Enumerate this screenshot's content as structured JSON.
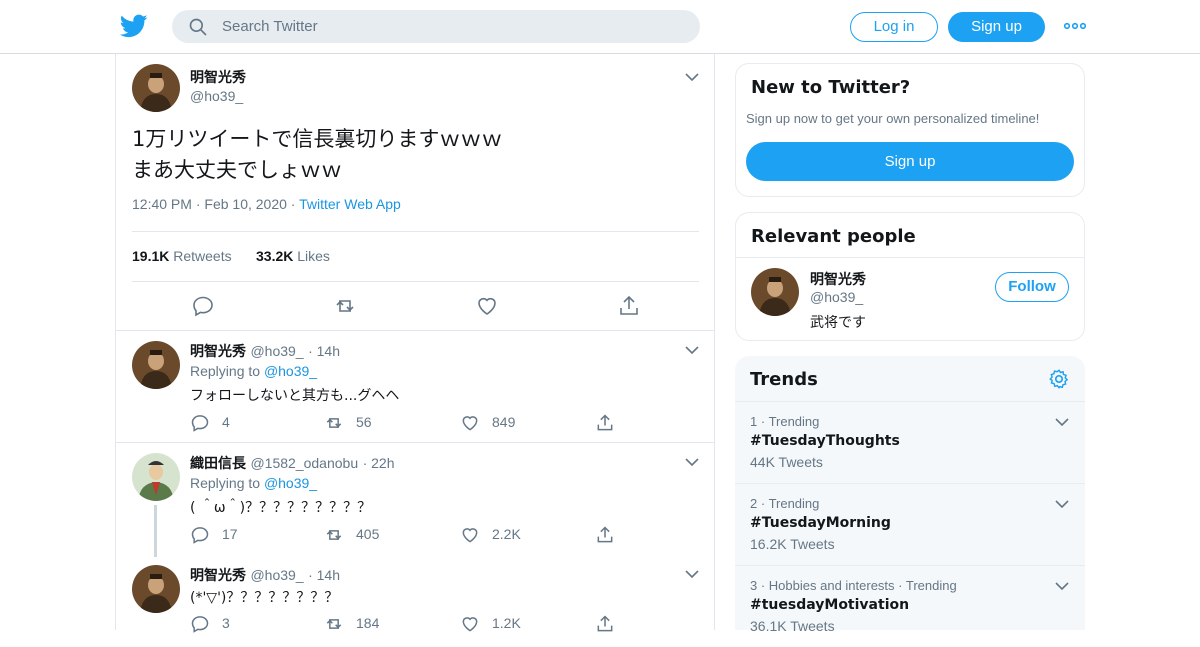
{
  "header": {
    "search_placeholder": "Search Twitter",
    "login_label": "Log in",
    "signup_label": "Sign up",
    "icons": [
      "twitter-logo-icon",
      "search-icon",
      "more-dots-icon"
    ],
    "accent_color": "#1da1f2"
  },
  "main_tweet": {
    "name": "明智光秀",
    "handle": "@ho39_",
    "text": "1万リツイートで信長裏切りますｗｗｗ\nまあ大丈夫でしょｗｗ",
    "time": "12:40 PM",
    "date": "Feb 10, 2020",
    "app": "Twitter Web App",
    "retweets_count": "19.1K",
    "retweets_label": "Retweets",
    "likes_count": "33.2K",
    "likes_label": "Likes"
  },
  "replies": [
    {
      "name": "明智光秀",
      "handle": "@ho39_",
      "time": "14h",
      "replying_prefix": "Replying to",
      "replying_to": "@ho39_",
      "text": "フォローしないと其方も...グヘヘ",
      "reply_count": "4",
      "retweet_count": "56",
      "like_count": "849"
    },
    {
      "name": "織田信長",
      "handle": "@1582_odanobu",
      "time": "22h",
      "replying_prefix": "Replying to",
      "replying_to": "@ho39_",
      "text": "( ＾ω＾)？？？？？？？？？",
      "reply_count": "17",
      "retweet_count": "405",
      "like_count": "2.2K"
    },
    {
      "name": "明智光秀",
      "handle": "@ho39_",
      "time": "14h",
      "replying_prefix": "",
      "replying_to": "",
      "text": "(*'▽')？？？？？？？？",
      "reply_count": "3",
      "retweet_count": "184",
      "like_count": "1.2K"
    }
  ],
  "new_to_twitter": {
    "title": "New to Twitter?",
    "subtitle": "Sign up now to get your own personalized timeline!",
    "signup_label": "Sign up"
  },
  "relevant_people": {
    "title": "Relevant people",
    "name": "明智光秀",
    "handle": "@ho39_",
    "bio": "武将です",
    "follow_label": "Follow"
  },
  "trends": {
    "title": "Trends",
    "items": [
      {
        "rank": "1",
        "category": "Trending",
        "tag": "#TuesdayThoughts",
        "count": "44K Tweets"
      },
      {
        "rank": "2",
        "category": "Trending",
        "tag": "#TuesdayMorning",
        "count": "16.2K Tweets"
      },
      {
        "rank": "3",
        "category": "Hobbies and interests · Trending",
        "tag": "#tuesdayMotivation",
        "count": "36.1K Tweets"
      }
    ]
  }
}
